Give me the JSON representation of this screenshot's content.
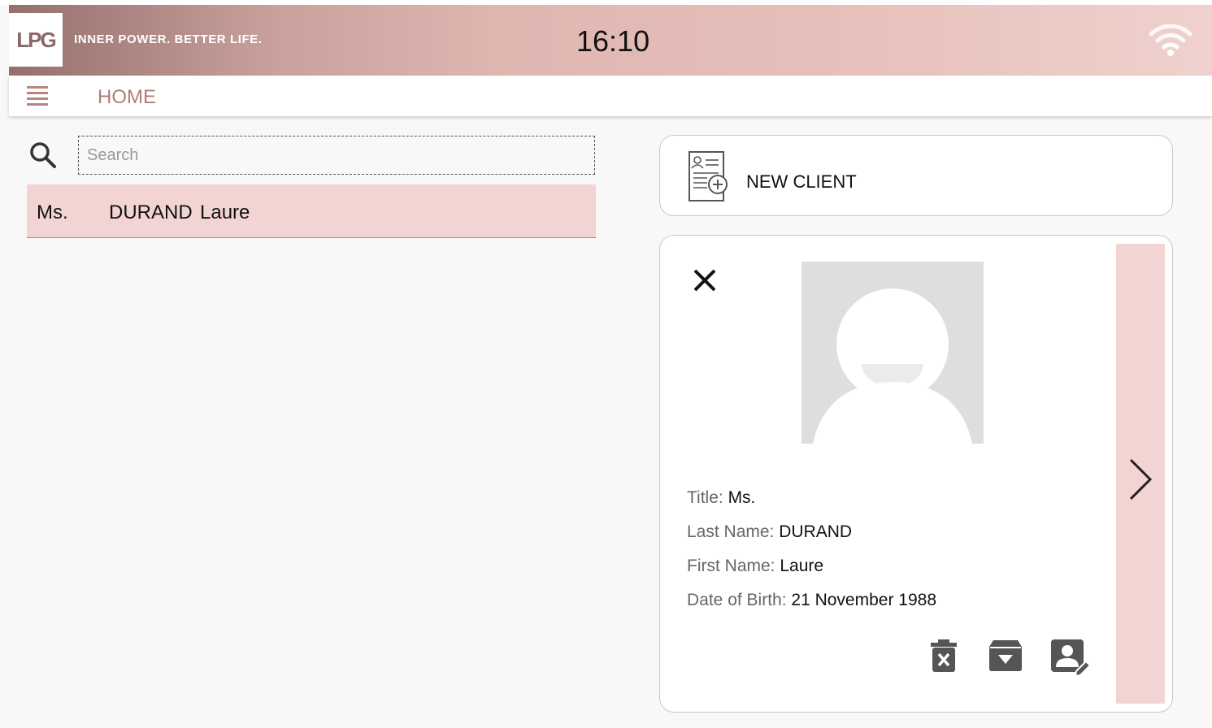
{
  "header": {
    "logo_text": "LPG",
    "tagline": "INNER POWER. BETTER LIFE.",
    "clock": "16:10",
    "status_icon": "wifi-icon"
  },
  "nav": {
    "menu_icon": "menu-icon",
    "title": "HOME"
  },
  "search": {
    "placeholder": "Search",
    "value": ""
  },
  "client_list": [
    {
      "title": "Ms.",
      "last_name": "DURAND",
      "first_name": "Laure"
    }
  ],
  "new_client": {
    "label": "NEW CLIENT",
    "icon": "add-client-document-icon"
  },
  "detail": {
    "fields": [
      {
        "label": "Title: ",
        "value": "Ms."
      },
      {
        "label": "Last Name: ",
        "value": "DURAND"
      },
      {
        "label": "First Name: ",
        "value": "Laure"
      },
      {
        "label": "Date of Birth: ",
        "value": "21 November 1988"
      }
    ],
    "actions": [
      "delete-icon",
      "archive-icon",
      "edit-profile-icon"
    ]
  },
  "colors": {
    "accent": "#b07d78",
    "selected_row": "#f2d5d3",
    "header_start": "#94706d",
    "header_end": "#efd1cd"
  }
}
